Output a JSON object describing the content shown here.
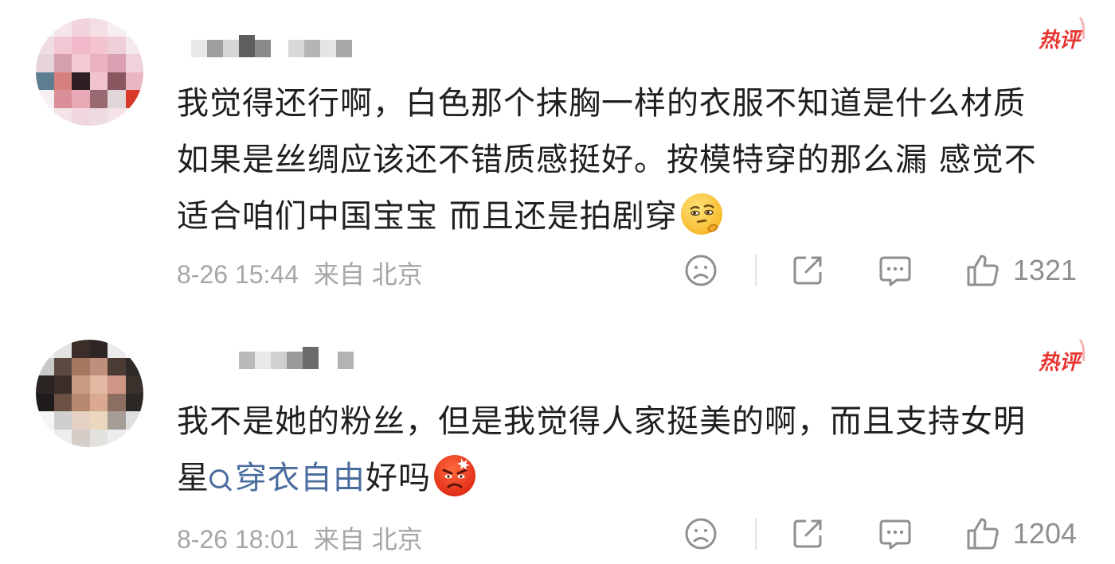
{
  "comments": [
    {
      "badge": "热评",
      "text": "我觉得还行啊，白色那个抹胸一样的衣服不知道是什么材质如果是丝绸应该还不错质感挺好。按模特穿的那么漏 感觉不适合咱们中国宝宝 而且还是拍剧穿",
      "emoji": "thinking-face-icon",
      "date": "8-26 15:44",
      "source": "来自 北京",
      "likes": "1321"
    },
    {
      "badge": "热评",
      "text_before": "我不是她的粉丝，但是我觉得人家挺美的啊，而且支持女明星",
      "hashtag": "穿衣自由",
      "text_after": "好吗",
      "emoji": "angry-face-icon",
      "date": "8-26 18:01",
      "source": "来自 北京",
      "likes": "1204"
    }
  ],
  "colors": {
    "hot_badge": "#e8332f",
    "hashtag": "#4a6d9e",
    "meta": "#a6a6a6",
    "icon": "#8f8f8f"
  },
  "icons": [
    "sad-face-icon",
    "share-icon",
    "comment-icon",
    "thumbs-up-icon"
  ]
}
